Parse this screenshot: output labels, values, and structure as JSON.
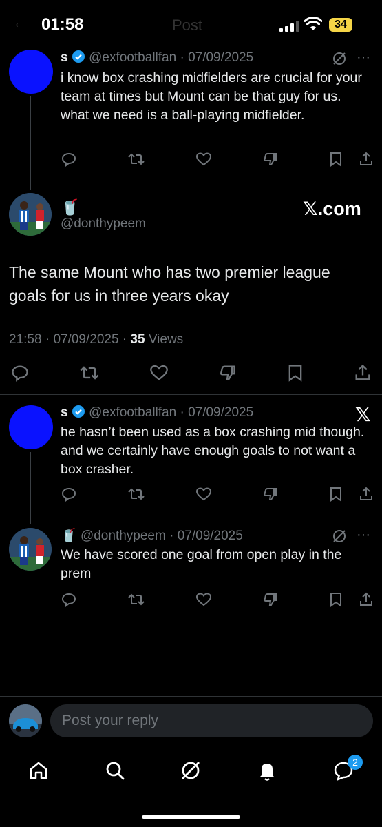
{
  "status_bar": {
    "time": "01:58",
    "battery": "34",
    "faded_title": "Post"
  },
  "tweets": [
    {
      "name": "s",
      "handle": "@exfootballfan",
      "date": "07/09/2025",
      "text": "i know box crashing midfielders are crucial for your team at times but Mount can be that guy for us. what we need is a ball-playing midfielder."
    },
    {
      "name": "🥤",
      "handle": "@donthypeem",
      "text": "The same Mount who has two premier league goals for us in three years okay",
      "time": "21:58",
      "date": "07/09/2025",
      "views_count": "35",
      "views_label": "Views",
      "watermark": "𝕏.com"
    },
    {
      "name": "s",
      "handle": "@exfootballfan",
      "date": "07/09/2025",
      "text": "he hasn’t been used as a box crashing mid though. and we certainly have enough goals to not want a box crasher."
    },
    {
      "name": "🥤",
      "handle": "@donthypeem",
      "date": "07/09/2025",
      "text": "We have scored one goal from open play in the prem"
    }
  ],
  "reply": {
    "placeholder": "Post your reply"
  },
  "nav": {
    "messages_badge": "2"
  },
  "colors": {
    "accent": "#1d9bf0",
    "muted": "#71767b",
    "background": "#000000"
  },
  "icons": [
    "reply-icon",
    "retweet-icon",
    "like-icon",
    "dislike-icon",
    "bookmark-icon",
    "share-icon",
    "grok-icon",
    "more-icon",
    "x-logo-icon",
    "home-icon",
    "search-icon",
    "grok-icon",
    "bell-icon",
    "messages-icon"
  ]
}
